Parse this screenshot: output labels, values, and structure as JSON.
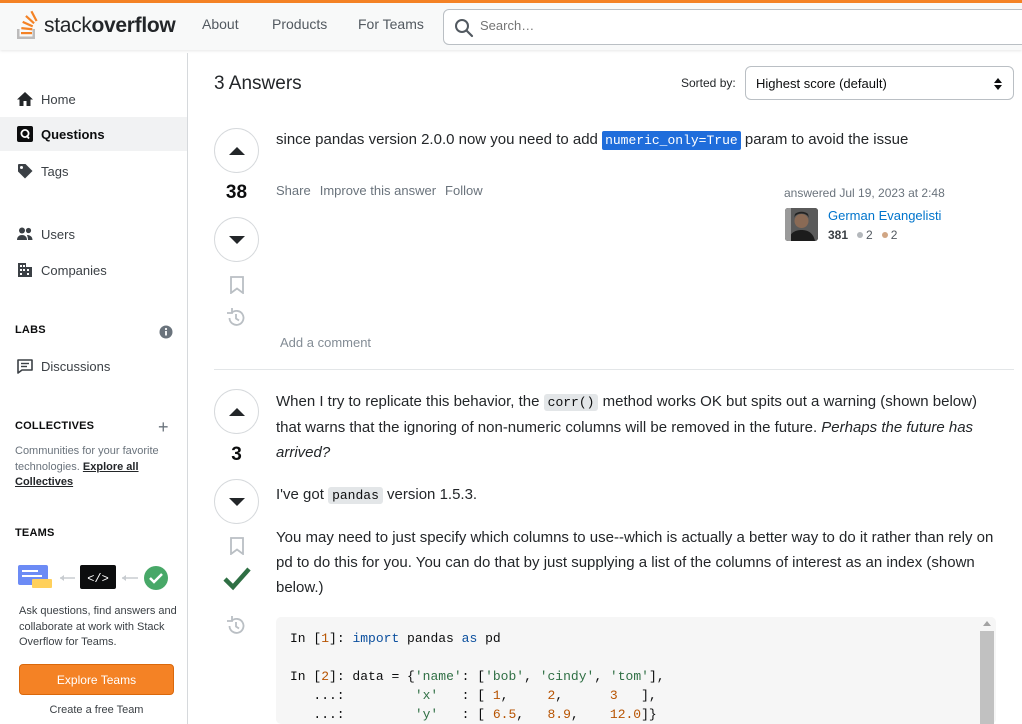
{
  "header": {
    "logo_word1": "stack",
    "logo_word2": "overflow",
    "nav": [
      "About",
      "Products",
      "For Teams"
    ],
    "search_placeholder": "Search…"
  },
  "sidebar": {
    "items": [
      {
        "label": "Home",
        "icon": "home-icon"
      },
      {
        "label": "Questions",
        "icon": "questions-icon",
        "active": true
      },
      {
        "label": "Tags",
        "icon": "tag-icon"
      },
      {
        "label": "Users",
        "icon": "users-icon"
      },
      {
        "label": "Companies",
        "icon": "companies-icon"
      }
    ],
    "labs_heading": "LABS",
    "discussions_label": "Discussions",
    "collectives_heading": "COLLECTIVES",
    "collectives_desc": "Communities for your favorite technologies.",
    "collectives_link": "Explore all Collectives",
    "teams_heading": "TEAMS",
    "teams_desc": "Ask questions, find answers and collaborate at work with Stack Overflow for Teams.",
    "explore_teams": "Explore Teams",
    "create_team": "Create a free Team"
  },
  "answers": {
    "title": "3 Answers",
    "sorted_label": "Sorted by:",
    "sort_value": "Highest score (default)"
  },
  "answer1": {
    "score": "38",
    "text_before": "since pandas version 2.0.0 now you need to add ",
    "code": "numeric_only=True",
    "text_after": " param to avoid the issue",
    "menu": [
      "Share",
      "Improve this answer",
      "Follow"
    ],
    "answered": "answered Jul 19, 2023 at 2:48",
    "user_name": "German Evangelisti",
    "user_rep": "381",
    "silver_badges": "2",
    "bronze_badges": "2",
    "add_comment": "Add a comment"
  },
  "answer2": {
    "score": "3",
    "p1_a": "When I try to replicate this behavior, the ",
    "p1_code": "corr()",
    "p1_b": " method works OK but spits out a warning (shown below) that warns that the ignoring of non-numeric columns will be removed in the future. ",
    "p1_em": "Perhaps the future has arrived?",
    "p2_a": "I've got ",
    "p2_code": "pandas",
    "p2_b": " version 1.5.3.",
    "p3": "You may need to just specify which columns to use--which is actually a better way to do it rather than rely on pd to do this for you. You can do that by just supplying a list of the columns of interest as an index (shown below.)",
    "code_lines": [
      "In [1]: import pandas as pd",
      "",
      "In [2]: data = {'name': ['bob', 'cindy', 'tom'],",
      "   ...:         'x'   : [ 1,     2,      3   ],",
      "   ...:         'y'   : [ 6.5,   8.9,    12.0]}"
    ]
  },
  "colors": {
    "accent": "#f48225",
    "link": "#0074cc",
    "accepted": "#2f6f44",
    "selection": "#1f6ddb"
  }
}
